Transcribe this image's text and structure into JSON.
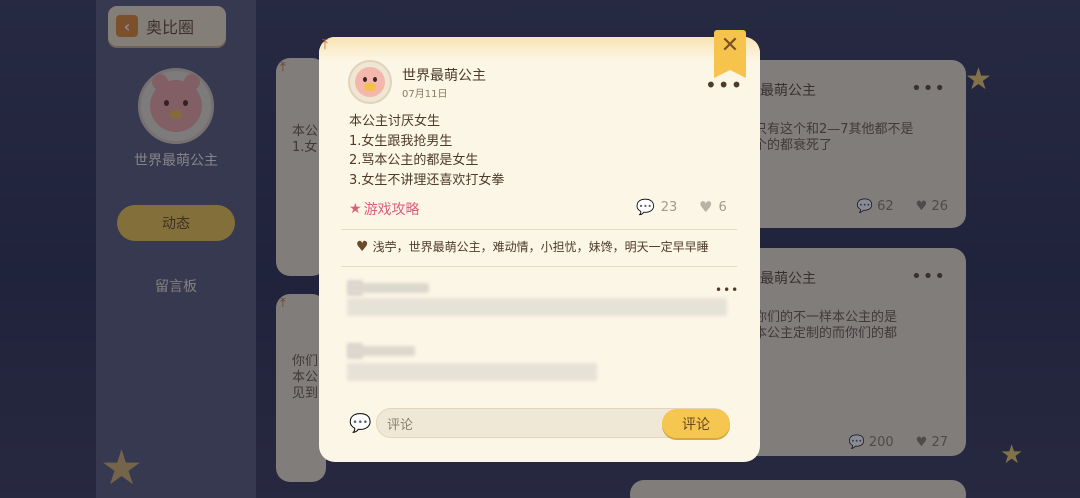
{
  "background": {
    "back_button_label": "奥比圈",
    "profile_name": "世界最萌公主",
    "tab_active": "动态",
    "tab_inactive": "留言板",
    "right_card_1": {
      "title": "最萌公主",
      "text_line1": "只有这个和2—7其他都不是",
      "text_line2": "个的都衰死了",
      "comments": "62",
      "likes": "26"
    },
    "right_card_2": {
      "title": "最萌公主",
      "text_line1": "你们的不一样本公主的是",
      "text_line2": "本公主定制的而你们的都",
      "comments": "200",
      "likes": "27"
    },
    "left_card_1_text": "本公\n1.女",
    "left_card_2_text": "你们\n本公\n见到"
  },
  "post": {
    "author": "世界最萌公主",
    "date": "07月11日",
    "body_lines": [
      "本公主讨厌女生",
      "1.女生跟我抢男生",
      "2.骂本公主的都是女生",
      "3.女生不讲理还喜欢打女拳"
    ],
    "tag": "游戏攻略",
    "comment_count": "23",
    "like_count": "6",
    "liked_by": "浅苧，世界最萌公主，难动情，小担忧，妹馋，明天一定早早睡"
  },
  "comment_box": {
    "placeholder": "评论",
    "submit_label": "评论"
  },
  "icons": {
    "close": "close-icon",
    "pin": "pin-icon",
    "more": "more-icon",
    "comment": "comment-bubble-icon",
    "like": "heart-icon",
    "tag": "star-icon"
  },
  "colors": {
    "accent_yellow": "#f5c750",
    "tag_pink": "#d95e7b",
    "dialog_bg": "#fcf6e6",
    "text_brown": "#4e3b2c"
  }
}
